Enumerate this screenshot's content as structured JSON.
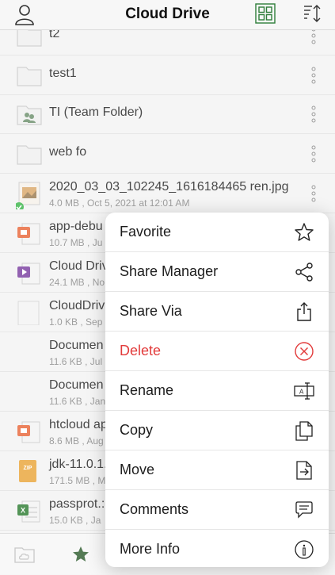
{
  "header": {
    "title": "Cloud Drive"
  },
  "files": [
    {
      "name": "t2",
      "meta": "",
      "type": "folder"
    },
    {
      "name": "test1",
      "meta": "",
      "type": "folder"
    },
    {
      "name": "TI (Team Folder)",
      "meta": "",
      "type": "team-folder"
    },
    {
      "name": "web fo",
      "meta": "",
      "type": "folder"
    },
    {
      "name": "2020_03_03_102245_1616184465 ren.jpg",
      "meta": "4.0 MB , Oct 5, 2021 at 12:01 AM",
      "type": "image"
    },
    {
      "name": "app-debu",
      "meta": "10.7 MB , Ju",
      "type": "ppt"
    },
    {
      "name": "Cloud Driv",
      "meta": "24.1 MB , No",
      "type": "video"
    },
    {
      "name": "CloudDrive",
      "meta": "1.0 KB , Sep",
      "type": "doc"
    },
    {
      "name": "Documen",
      "meta": "11.6 KB , Jul",
      "type": "doc"
    },
    {
      "name": "Documen",
      "meta": "11.6 KB , Jan",
      "type": "doc"
    },
    {
      "name": "htcloud ap",
      "meta": "8.6 MB , Aug",
      "type": "ppt"
    },
    {
      "name": "jdk-11.0.1.",
      "meta": "171.5 MB , M",
      "type": "zip"
    },
    {
      "name": "passprot.:",
      "meta": "15.0 KB , Ja",
      "type": "excel"
    }
  ],
  "file_icons": {
    "zip_label": "ZIP",
    "excel_label": "X"
  },
  "context_menu": {
    "items": [
      {
        "label": "Favorite",
        "icon": "star-icon"
      },
      {
        "label": "Share Manager",
        "icon": "share-nodes-icon"
      },
      {
        "label": "Share Via",
        "icon": "share-upload-icon"
      },
      {
        "label": "Delete",
        "icon": "delete-circle-x-icon",
        "color": "#e23b3b"
      },
      {
        "label": "Rename",
        "icon": "rename-icon"
      },
      {
        "label": "Copy",
        "icon": "copy-icon"
      },
      {
        "label": "Move",
        "icon": "move-icon"
      },
      {
        "label": "Comments",
        "icon": "comment-icon"
      },
      {
        "label": "More Info",
        "icon": "info-icon"
      }
    ]
  },
  "tabbar": {
    "items": [
      {
        "icon": "cloud-folder-icon"
      },
      {
        "icon": "favorites-star-icon"
      }
    ]
  },
  "colors": {
    "accent_green": "#2f7d3a",
    "delete_red": "#e23b3b",
    "success_green": "#3bb54a"
  }
}
